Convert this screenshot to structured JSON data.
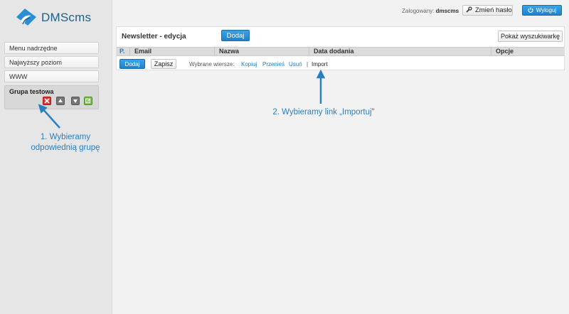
{
  "app": {
    "name": "DMScms",
    "brand_color": "#1f5f86",
    "accent_color": "#2a8fd6"
  },
  "sidebar": {
    "items": [
      {
        "label": "Menu nadrzędne"
      },
      {
        "label": "Najwyższy poziom"
      },
      {
        "label": "WWW"
      }
    ],
    "group": {
      "label": "Grupa testowa",
      "actions": [
        "delete-icon",
        "arrow-up-icon",
        "arrow-down-icon",
        "edit-icon"
      ]
    }
  },
  "header": {
    "logged_label": "Zalogowany:",
    "user": "dmscms",
    "change_password_label": "Zmień hasło",
    "logout_label": "Wyloguj"
  },
  "panel": {
    "title": "Newsletter - edycja",
    "add_label": "Dodaj",
    "search_toggle_label": "Pokaż wyszukiwarkę",
    "columns": [
      "P.",
      "Email",
      "Nazwa",
      "Data dodania",
      "Opcje"
    ],
    "actions": {
      "add_label": "Dodaj",
      "save_label": "Zapisz",
      "selected_rows_label": "Wybrane wiersze:",
      "copy_label": "Kopiuj",
      "move_label": "Przenieś",
      "delete_label": "Usuń",
      "separator": "|",
      "import_label": "Import"
    }
  },
  "annotations": {
    "step1_line1": "1. Wybieramy",
    "step1_line2": "odpowiednią grupę",
    "step2": "2. Wybieramy link „Importuj\""
  }
}
